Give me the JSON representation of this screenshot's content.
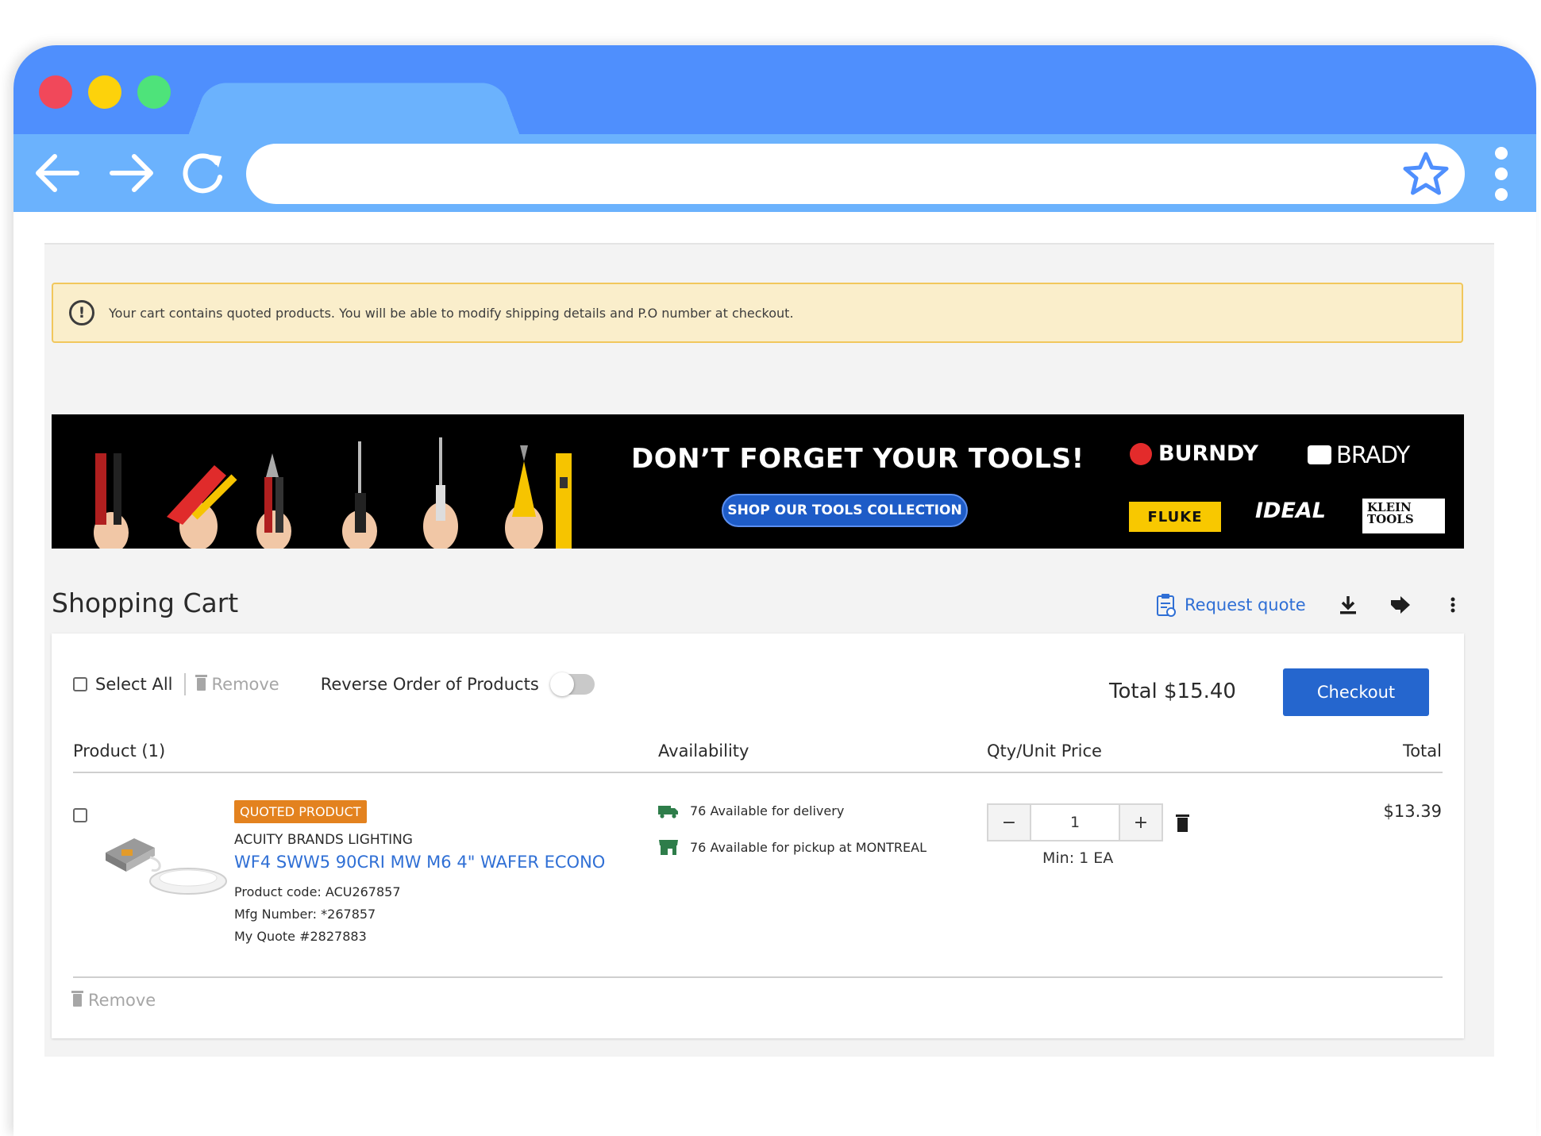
{
  "alert": {
    "text": "Your cart contains quoted products. You will be able to modify shipping details and P.O number at checkout.",
    "icon": "info-circle-icon"
  },
  "banner": {
    "title": "DON’T FORGET YOUR TOOLS!",
    "button": "SHOP OUR TOOLS COLLECTION",
    "brands": [
      "BURNDY",
      "BRADY",
      "FLUKE",
      "IDEAL",
      "KLEIN TOOLS"
    ]
  },
  "cart": {
    "title": "Shopping Cart",
    "request_quote": "Request quote",
    "select_all": "Select All",
    "remove": "Remove",
    "reverse_order": "Reverse Order of Products",
    "reverse_order_on": false,
    "total": "Total $15.40",
    "checkout": "Checkout",
    "columns": {
      "product": "Product (1)",
      "availability": "Availability",
      "qty_price": "Qty/Unit Price",
      "total": "Total"
    },
    "items": [
      {
        "badge": "QUOTED PRODUCT",
        "brand": "ACUITY BRANDS LIGHTING",
        "name": "WF4 SWW5 90CRI MW M6 4\" WAFER ECONO",
        "product_code": "Product code:  ACU267857",
        "mfg_number": "Mfg Number: *267857",
        "quote": "My Quote #2827883",
        "availability": [
          "76 Available for delivery",
          "76 Available for pickup at MONTREAL"
        ],
        "qty": "1",
        "min": "Min: 1 EA",
        "total": "$13.39"
      }
    ],
    "bottom_remove": "Remove"
  },
  "colors": {
    "browser_tab_bar": "#4f8ffd",
    "browser_toolbar": "#6bb2fd",
    "accent": "#2566ce",
    "link": "#2f6fd5",
    "badge": "#e3821f",
    "alert_bg": "#faeecb",
    "alert_border": "#f1c75c",
    "availability_icon": "#2e7d4a"
  }
}
